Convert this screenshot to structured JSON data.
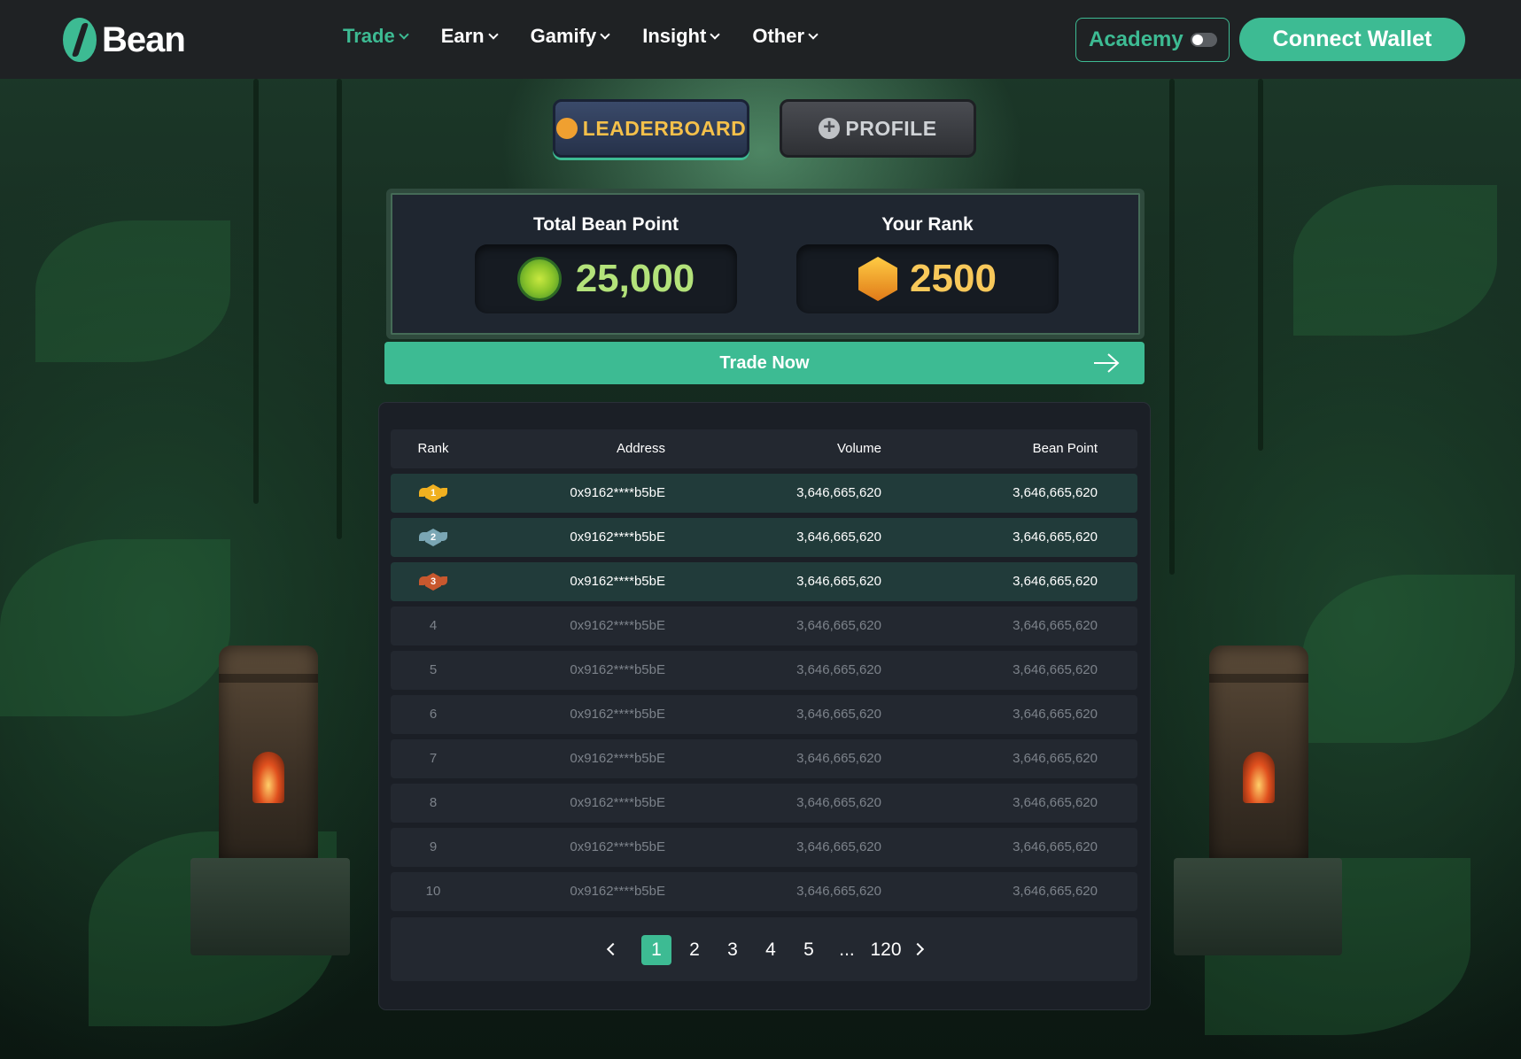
{
  "header": {
    "logo_text": "Bean",
    "nav": [
      {
        "label": "Trade",
        "active": true
      },
      {
        "label": "Earn"
      },
      {
        "label": "Gamify"
      },
      {
        "label": "Insight"
      },
      {
        "label": "Other"
      }
    ],
    "academy_label": "Academy",
    "academy_toggle": "off",
    "connect_label": "Connect Wallet"
  },
  "tabs": {
    "leaderboard": "LEADERBOARD",
    "profile": "PROFILE",
    "active": "leaderboard"
  },
  "stats": {
    "total_title": "Total Bean Point",
    "total_value": "25,000",
    "rank_title": "Your Rank",
    "rank_value": "2500"
  },
  "trade_now_label": "Trade Now",
  "table": {
    "headers": {
      "rank": "Rank",
      "address": "Address",
      "volume": "Volume",
      "bean_point": "Bean Point"
    },
    "rows": [
      {
        "rank": "1",
        "address": "0x9162****b5bE",
        "volume": "3,646,665,620",
        "bean_point": "3,646,665,620",
        "badge": "gold"
      },
      {
        "rank": "2",
        "address": "0x9162****b5bE",
        "volume": "3,646,665,620",
        "bean_point": "3,646,665,620",
        "badge": "silver"
      },
      {
        "rank": "3",
        "address": "0x9162****b5bE",
        "volume": "3,646,665,620",
        "bean_point": "3,646,665,620",
        "badge": "bronze"
      },
      {
        "rank": "4",
        "address": "0x9162****b5bE",
        "volume": "3,646,665,620",
        "bean_point": "3,646,665,620"
      },
      {
        "rank": "5",
        "address": "0x9162****b5bE",
        "volume": "3,646,665,620",
        "bean_point": "3,646,665,620"
      },
      {
        "rank": "6",
        "address": "0x9162****b5bE",
        "volume": "3,646,665,620",
        "bean_point": "3,646,665,620"
      },
      {
        "rank": "7",
        "address": "0x9162****b5bE",
        "volume": "3,646,665,620",
        "bean_point": "3,646,665,620"
      },
      {
        "rank": "8",
        "address": "0x9162****b5bE",
        "volume": "3,646,665,620",
        "bean_point": "3,646,665,620"
      },
      {
        "rank": "9",
        "address": "0x9162****b5bE",
        "volume": "3,646,665,620",
        "bean_point": "3,646,665,620"
      },
      {
        "rank": "10",
        "address": "0x9162****b5bE",
        "volume": "3,646,665,620",
        "bean_point": "3,646,665,620"
      }
    ]
  },
  "pagination": {
    "pages": [
      "1",
      "2",
      "3",
      "4",
      "5",
      "...",
      "120"
    ],
    "current": "1"
  },
  "colors": {
    "accent": "#3dbb93",
    "header_bg": "#1f2224",
    "gold": "#f8c85a",
    "green_value": "#b3e27a"
  },
  "icons": {
    "logo": "bean-leaf-logo-icon",
    "leaderboard_tab": "medal-icon",
    "profile_tab": "plus-circle-icon",
    "total_points": "gem-icon",
    "rank": "crown-medal-icon",
    "trade_now": "arrow-right-icon",
    "prev": "chevron-left-icon",
    "next": "chevron-right-icon"
  }
}
